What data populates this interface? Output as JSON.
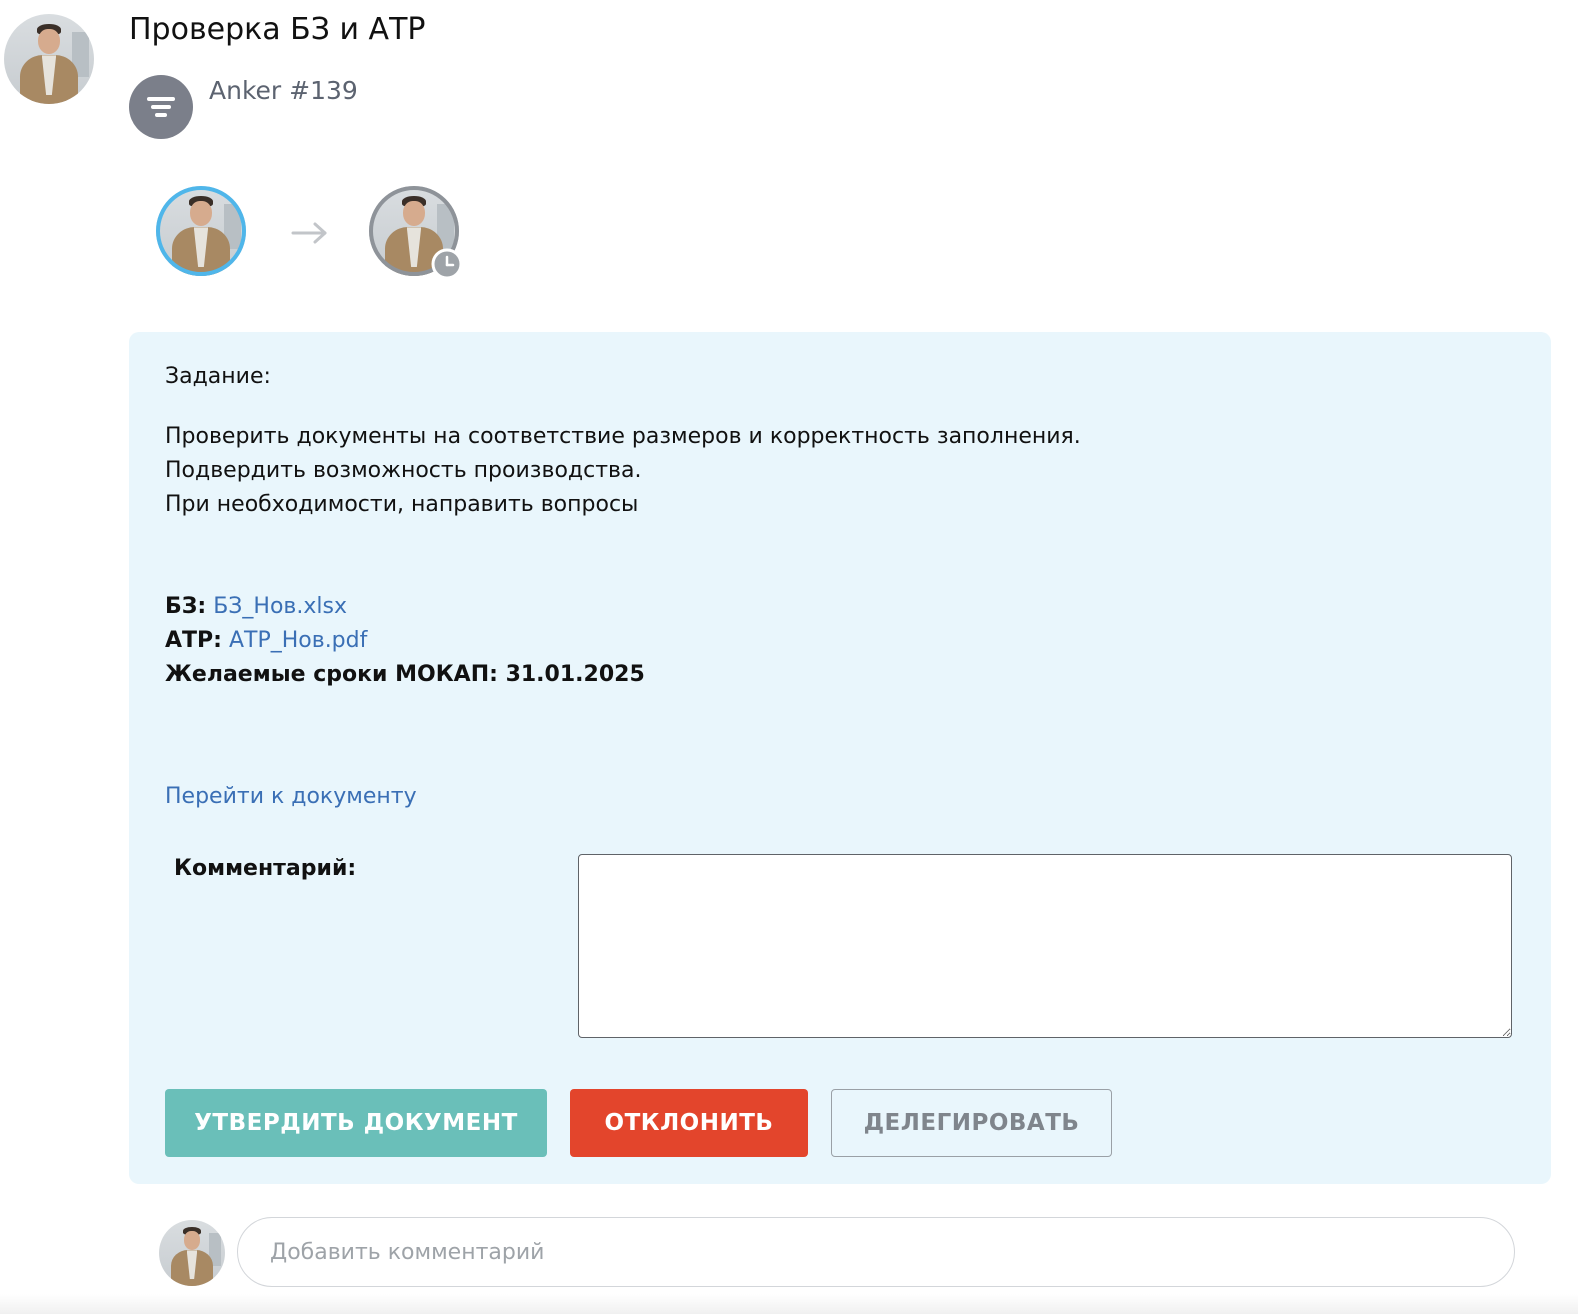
{
  "header": {
    "title": "Проверка БЗ и АТР",
    "source_name": "Anker #139",
    "source_icon": "filter-icon"
  },
  "route": {
    "steps": [
      {
        "status": "active",
        "ring_color": "#4fb6ea"
      },
      {
        "status": "pending",
        "ring_color": "#8e9399",
        "badge_icon": "clock-icon"
      }
    ],
    "arrow_icon": "arrow-right-icon"
  },
  "task": {
    "label": "Задание:",
    "description_lines": [
      "Проверить документы на соответствие размеров и корректность заполнения.",
      "Подвердить возможность производства.",
      "При необходимости, направить вопросы"
    ],
    "attachments": [
      {
        "label": "БЗ:",
        "file": "БЗ_Нов.xlsx"
      },
      {
        "label": "АТР:",
        "file": "АТР_Нов.pdf"
      }
    ],
    "deadline_text": "Желаемые сроки МОКАП: 31.01.2025",
    "goto_document": "Перейти к документу",
    "comment_label": "Комментарий:",
    "comment_value": ""
  },
  "actions": {
    "approve": "УТВЕРДИТЬ ДОКУМЕНТ",
    "reject": "ОТКЛОНИТЬ",
    "delegate": "ДЕЛЕГИРОВАТЬ"
  },
  "footer": {
    "comment_placeholder": "Добавить комментарий"
  },
  "colors": {
    "card_background": "#e9f6fc",
    "link": "#3a6fb5",
    "approve": "#6abfb9",
    "reject": "#e3452c",
    "delegate_text": "#7f858c"
  }
}
